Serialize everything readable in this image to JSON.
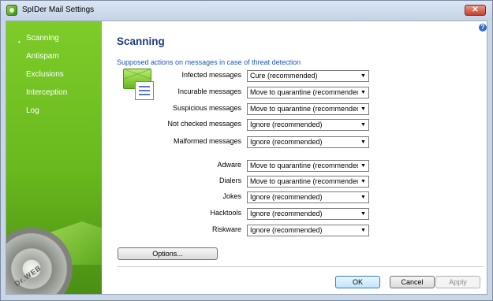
{
  "window": {
    "title": "SpIDer Mail Settings",
    "close_glyph": "✕"
  },
  "help": {
    "glyph": "?"
  },
  "sidebar": {
    "bullet": "•",
    "brand_mark": "Dr.WEB",
    "items": [
      {
        "label": "Scanning",
        "selected": true
      },
      {
        "label": "Antispam",
        "selected": false
      },
      {
        "label": "Exclusions",
        "selected": false
      },
      {
        "label": "Interception",
        "selected": false
      },
      {
        "label": "Log",
        "selected": false
      }
    ]
  },
  "main": {
    "title": "Scanning",
    "subtitle": "Supposed actions on messages in case of threat detection",
    "rows": [
      {
        "label": "Infected messages",
        "value": "Cure (recommended)"
      },
      {
        "label": "Incurable messages",
        "value": "Move to quarantine (recommended"
      },
      {
        "label": "Suspicious messages",
        "value": "Move to quarantine (recommended"
      },
      {
        "label": "Not checked messages",
        "value": "Ignore (recommended)"
      },
      {
        "label": "Malformed messages",
        "value": "Ignore (recommended)"
      },
      {
        "label": "Adware",
        "value": "Move to quarantine (recommended"
      },
      {
        "label": "Dialers",
        "value": "Move to quarantine (recommended"
      },
      {
        "label": "Jokes",
        "value": "Ignore (recommended)"
      },
      {
        "label": "Hacktools",
        "value": "Ignore (recommended)"
      },
      {
        "label": "Riskware",
        "value": "Ignore (recommended)"
      }
    ],
    "options_label": "Options..."
  },
  "buttons": {
    "ok": "OK",
    "cancel": "Cancel",
    "apply": "Apply"
  },
  "icons": {
    "dropdown_arrow": "▼"
  },
  "colors": {
    "sidebar_green": "#69b81d",
    "title_blue": "#1c3e7e",
    "link_blue": "#1a56b8"
  }
}
